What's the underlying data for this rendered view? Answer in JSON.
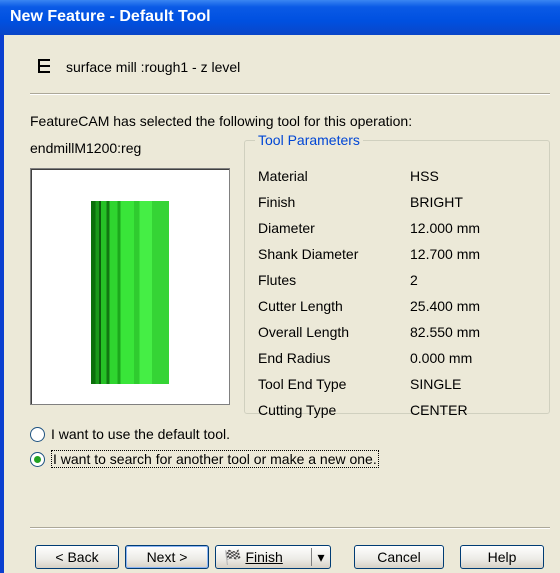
{
  "window": {
    "title": "New Feature - Default Tool"
  },
  "operation": {
    "icon": "list-icon",
    "label": "surface mill :rough1 - z level"
  },
  "intro_text": "FeatureCAM has selected the following tool for this operation:",
  "tool": {
    "name": "endmillM1200:reg"
  },
  "tool_parameters": {
    "legend": "Tool Parameters",
    "rows": [
      {
        "label": "Material",
        "value": "HSS"
      },
      {
        "label": "Finish",
        "value": "BRIGHT"
      },
      {
        "label": "Diameter",
        "value": "12.000 mm"
      },
      {
        "label": "Shank Diameter",
        "value": "12.700 mm"
      },
      {
        "label": "Flutes",
        "value": "2"
      },
      {
        "label": "Cutter Length",
        "value": "25.400 mm"
      },
      {
        "label": "Overall Length",
        "value": "82.550 mm"
      },
      {
        "label": "End Radius",
        "value": "0.000 mm"
      },
      {
        "label": "Tool End Type",
        "value": "SINGLE"
      },
      {
        "label": "Cutting Type",
        "value": "CENTER"
      }
    ]
  },
  "options": [
    {
      "label": "I want to use the default tool.",
      "selected": false
    },
    {
      "label": "I want to search for another tool or make a new one.",
      "selected": true
    }
  ],
  "buttons": {
    "back": "< Back",
    "next": "Next >",
    "finish": "Finish",
    "cancel": "Cancel",
    "help": "Help"
  },
  "colors": {
    "title_bar": "#0A5AE6",
    "legend": "#0046D5",
    "cutter": "#2FD52F"
  }
}
